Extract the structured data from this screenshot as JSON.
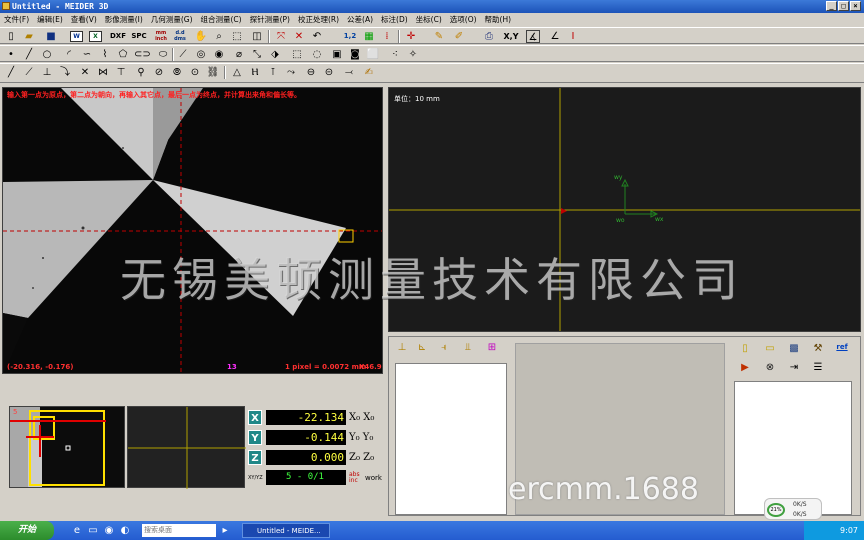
{
  "window": {
    "title": "Untitled - MEIDER 3D",
    "min": "_",
    "max": "□",
    "close": "×"
  },
  "menu": [
    "文件(F)",
    "编辑(E)",
    "查看(V)",
    "影像测量(I)",
    "几何测量(G)",
    "组合测量(C)",
    "探针测量(P)",
    "校正处理(R)",
    "公差(A)",
    "标注(D)",
    "坐标(C)",
    "选项(O)",
    "帮助(H)"
  ],
  "toolbar1": {
    "dxf": "DXF",
    "spc": "SPC",
    "mm_inch": "mm inch",
    "dms": "d.d dms",
    "xy": "X,Y",
    "ref": "1,2"
  },
  "camera": {
    "hint": "输入第一点为原点，第二点为朝向，再输入其它点，最后一点为终点，并计算出来角和偏长等。",
    "coords": "(-20.316, -0.176)",
    "frame": "13",
    "pixel": "1 pixel = 0.0072 mm",
    "zoom": "X46.9"
  },
  "cad": {
    "unit": "单位：10 mm",
    "wy": "wy",
    "wx": "wx",
    "wo": "wo"
  },
  "mini": {
    "label": "5"
  },
  "coords": [
    {
      "axis": "X",
      "value": "-22.134",
      "sub": "X₀ X₀"
    },
    {
      "axis": "Y",
      "value": "-0.144",
      "sub": "Y₀ Y₀"
    },
    {
      "axis": "Z",
      "value": "0.000",
      "sub": "Z₀ Z₀"
    }
  ],
  "coordextra": {
    "xy": "XY/YZ",
    "value": "5 - 0/1",
    "abs": "abs inc",
    "work": "work"
  },
  "bottom": {
    "ref": "ref"
  },
  "taskbar": {
    "start": "开始",
    "search": "搜索桌面",
    "task": "Untitled - MEIDE...",
    "time": "9:07"
  },
  "net": {
    "pct": "21%",
    "up": "0K/S",
    "down": "0K/S"
  },
  "watermark": "无锡美顿测量技术有限公司",
  "watermark2": "ercmm.1688"
}
